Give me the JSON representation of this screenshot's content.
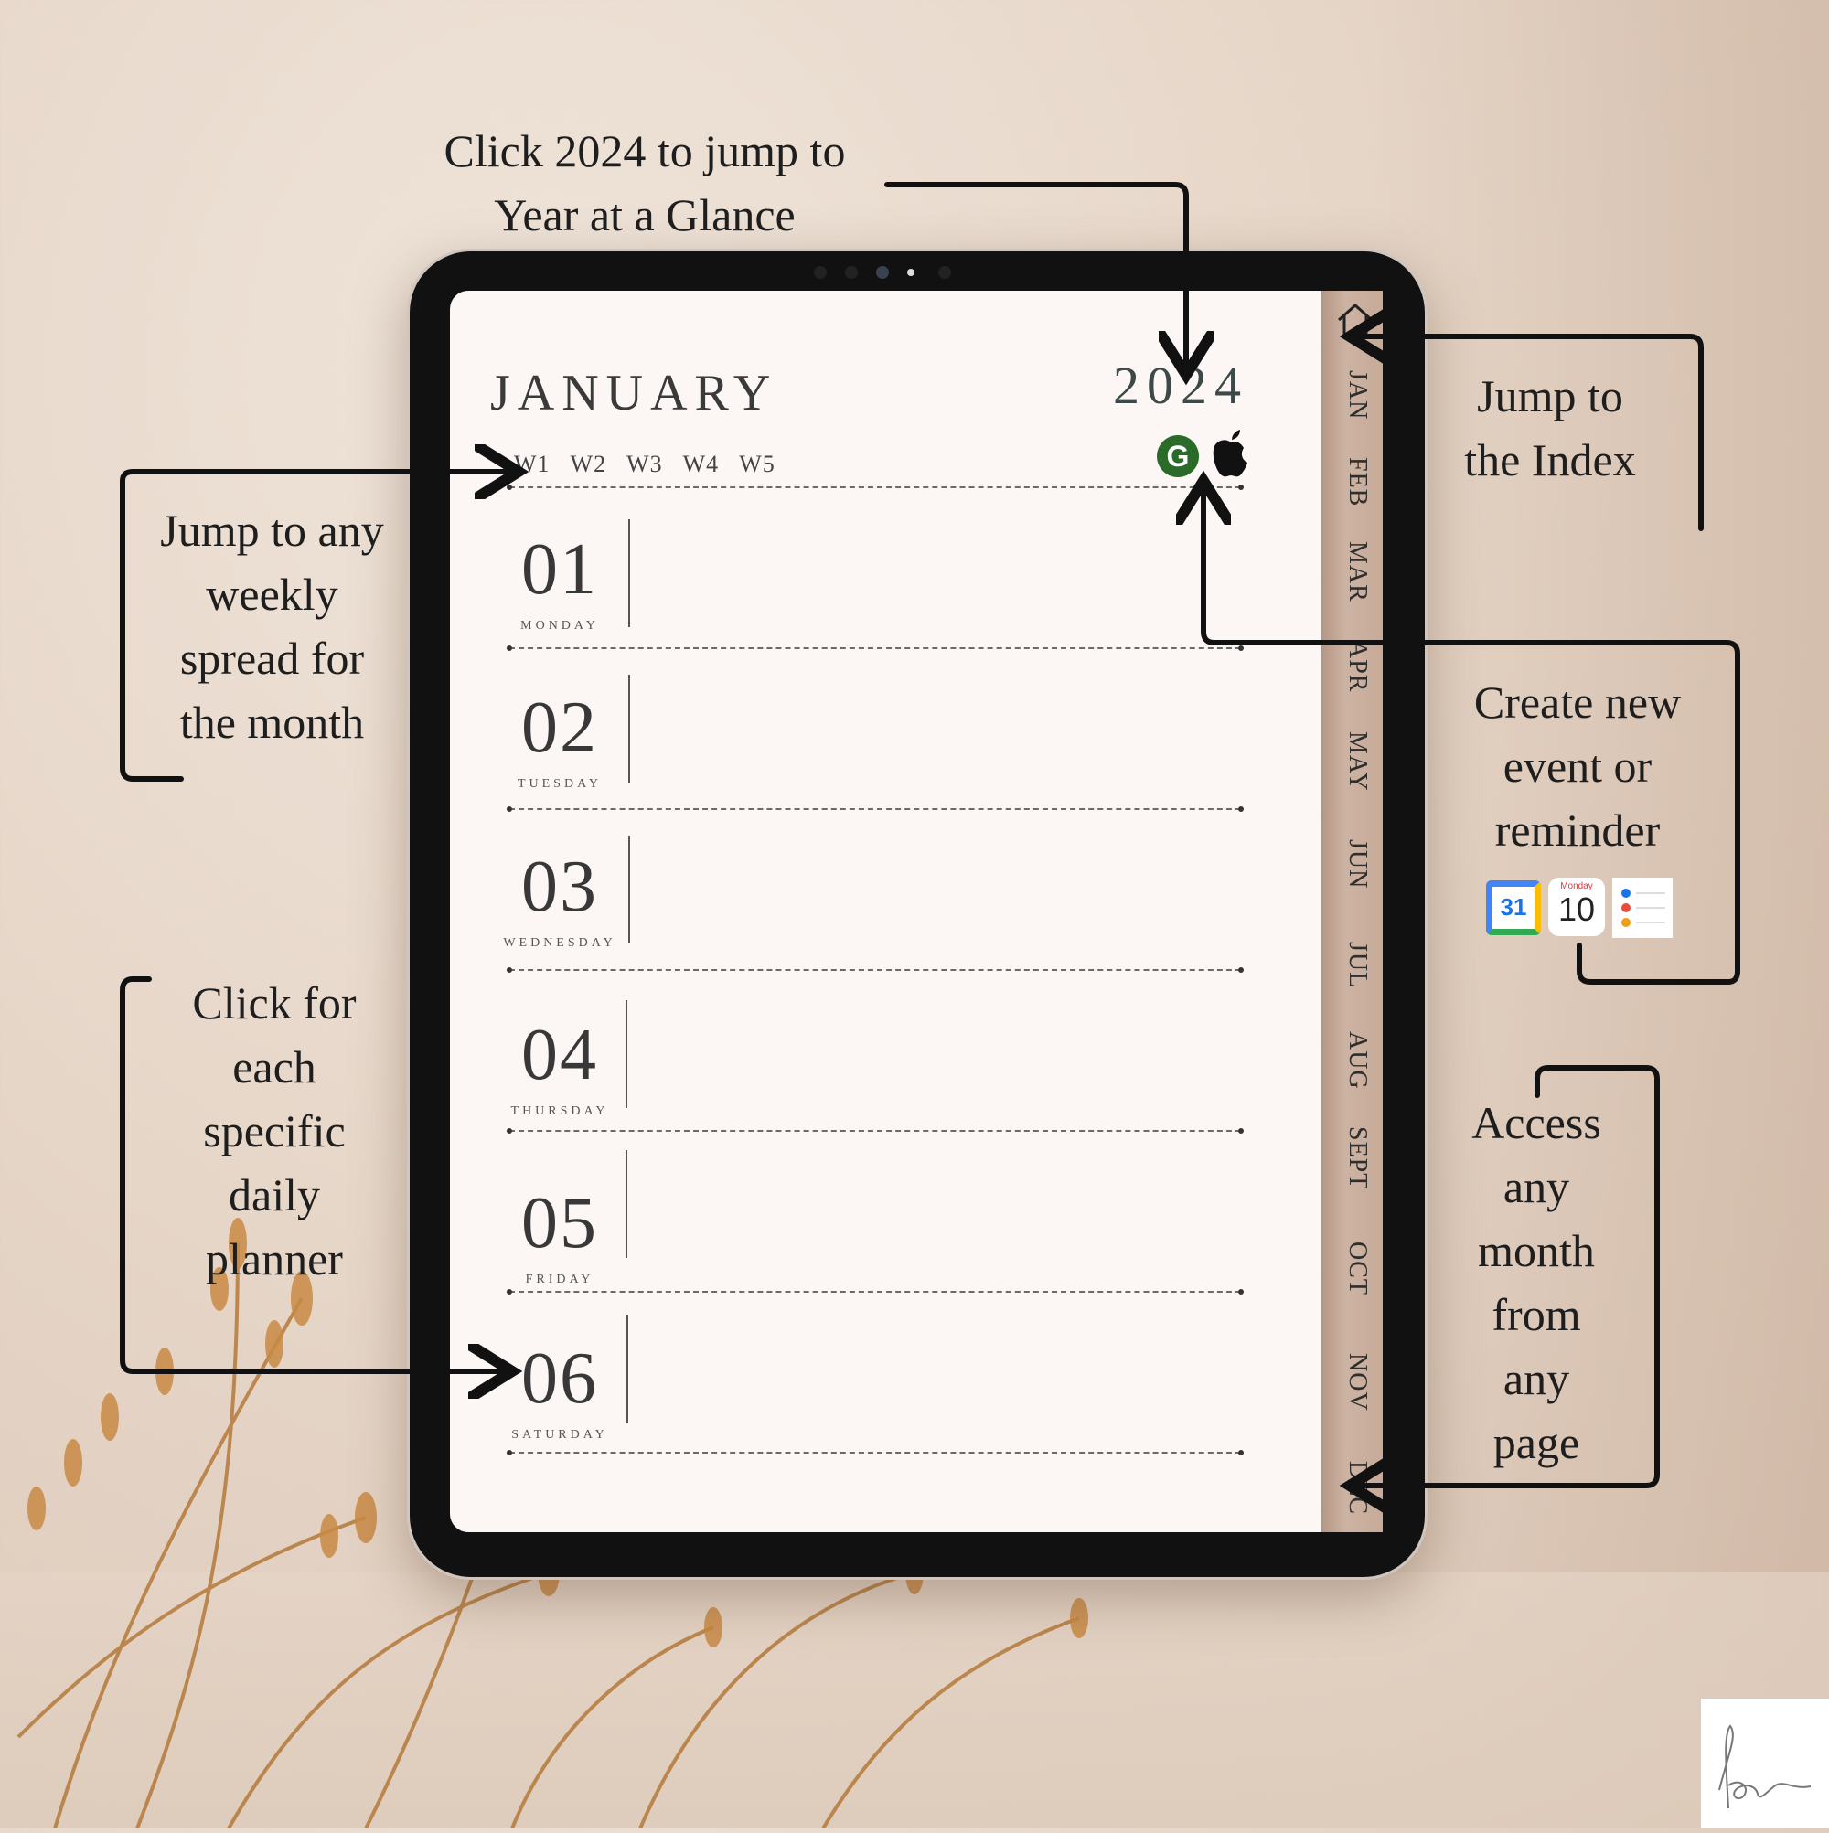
{
  "planner": {
    "month_title": "JANUARY",
    "year": "2024",
    "weeks": [
      "W1",
      "W2",
      "W3",
      "W4",
      "W5"
    ],
    "days": [
      {
        "num": "01",
        "name": "MONDAY"
      },
      {
        "num": "02",
        "name": "TUESDAY"
      },
      {
        "num": "03",
        "name": "WEDNESDAY"
      },
      {
        "num": "04",
        "name": "THURSDAY"
      },
      {
        "num": "05",
        "name": "FRIDAY"
      },
      {
        "num": "06",
        "name": "SATURDAY"
      }
    ],
    "google_icon_letter": "G"
  },
  "month_tabs": [
    "JAN",
    "FEB",
    "MAR",
    "APR",
    "MAY",
    "JUN",
    "JUL",
    "AUG",
    "SEPT",
    "OCT",
    "NOV",
    "DEC"
  ],
  "callouts": {
    "year_line1": "Click 2024 to jump to",
    "year_line2": "Year at a Glance",
    "index_line1": "Jump to",
    "index_line2": "the Index",
    "weekly": [
      "Jump to any",
      "weekly",
      "spread for",
      "the month"
    ],
    "event": [
      "Create new",
      "event or",
      "reminder"
    ],
    "daily": [
      "Click for",
      "each",
      "specific",
      "daily",
      "planner"
    ],
    "month_access": [
      "Access",
      "any",
      "month",
      "from",
      "any",
      "page"
    ]
  },
  "app_icons": {
    "google_calendar_day": "31",
    "apple_calendar_weekday": "Monday",
    "apple_calendar_day": "10"
  },
  "icons": [
    "home-icon",
    "google-calendar-g-icon",
    "apple-icon",
    "google-calendar-icon",
    "apple-calendar-icon",
    "reminders-icon",
    "signature-logo"
  ]
}
